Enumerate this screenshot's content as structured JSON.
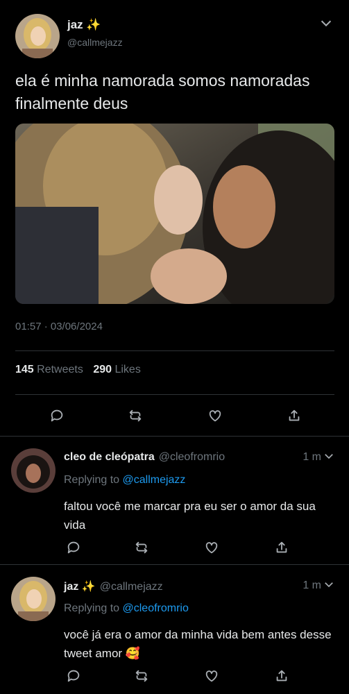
{
  "tweet": {
    "display_name": "jaz",
    "sparkle": "✨",
    "handle": "@callmejazz",
    "text": "ela é minha namorada somos namoradas finalmente deus",
    "timestamp": "01:57 · 03/06/2024",
    "retweets_count": "145",
    "retweets_label": "Retweets",
    "likes_count": "290",
    "likes_label": "Likes"
  },
  "replies": [
    {
      "display_name": "cleo de cleópatra",
      "handle": "@cleofromrio",
      "time": "1 m",
      "replying_prefix": "Replying to",
      "replying_to": "@callmejazz",
      "text": "faltou você me marcar pra eu ser o amor da sua vida"
    },
    {
      "display_name": "jaz",
      "sparkle": "✨",
      "handle": "@callmejazz",
      "time": "1 m",
      "replying_prefix": "Replying to",
      "replying_to": "@cleofromrio",
      "text": "você já era o amor da minha vida bem antes desse tweet amor",
      "emoji": "🥰"
    }
  ],
  "icons": [
    "chevron-down-icon",
    "reply-icon",
    "retweet-icon",
    "like-icon",
    "share-icon"
  ],
  "colors": {
    "background": "#000000",
    "text": "#e7e9ea",
    "muted": "#6e767d",
    "link": "#1d9bf0",
    "divider": "#2f3336"
  }
}
